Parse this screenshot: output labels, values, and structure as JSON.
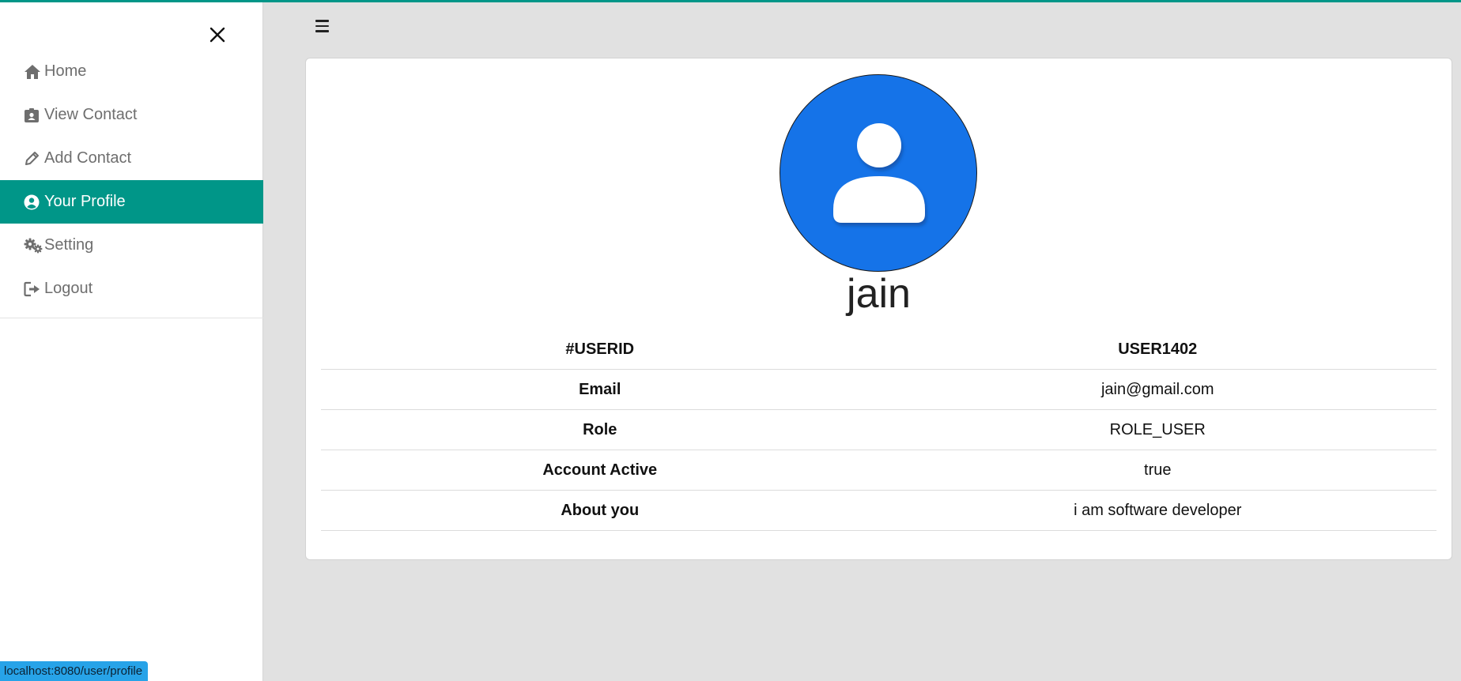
{
  "colors": {
    "accent": "#009688",
    "avatar_bg": "#1573e8",
    "status_bg": "#27a3e8",
    "page_bg": "#e1e1e1"
  },
  "sidebar": {
    "close_icon": "close-icon",
    "items": [
      {
        "label": "Home",
        "icon": "home-icon",
        "active": false
      },
      {
        "label": "View Contact",
        "icon": "contact-card-icon",
        "active": false
      },
      {
        "label": "Add Contact",
        "icon": "pencil-icon",
        "active": false
      },
      {
        "label": "Your Profile",
        "icon": "user-circle-icon",
        "active": true
      },
      {
        "label": "Setting",
        "icon": "gears-icon",
        "active": false
      },
      {
        "label": "Logout",
        "icon": "logout-icon",
        "active": false
      }
    ]
  },
  "topbar": {
    "menu_icon": "hamburger-icon"
  },
  "profile": {
    "avatar_icon": "person-avatar-icon",
    "name": "jain",
    "rows": [
      {
        "key": "#USERID",
        "value": "USER1402"
      },
      {
        "key": "Email",
        "value": "jain@gmail.com"
      },
      {
        "key": "Role",
        "value": "ROLE_USER"
      },
      {
        "key": "Account Active",
        "value": "true"
      },
      {
        "key": "About you",
        "value": "i am software developer"
      }
    ]
  },
  "status_bar": {
    "url": "localhost:8080/user/profile"
  }
}
